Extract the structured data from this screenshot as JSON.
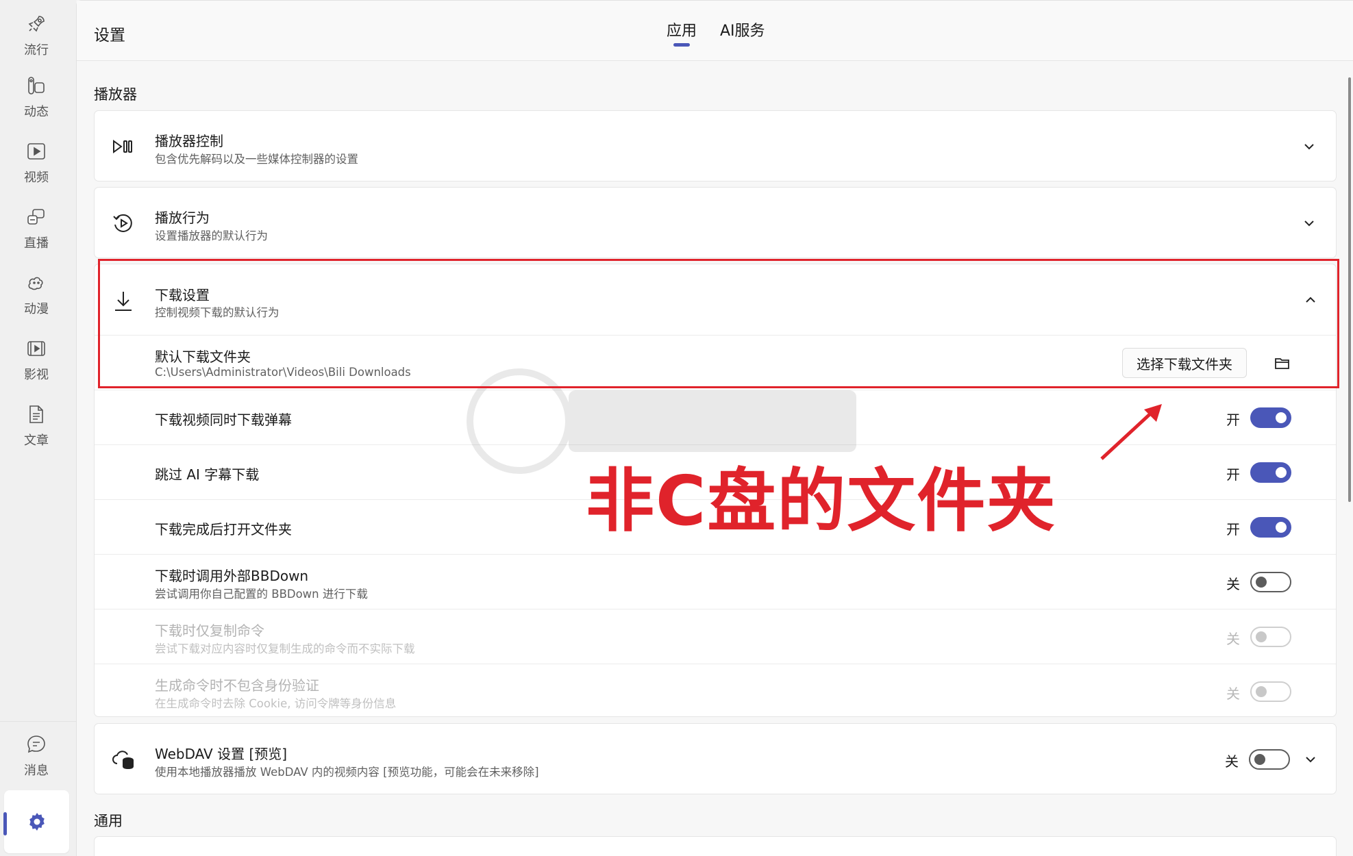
{
  "sidebar": {
    "items": [
      {
        "label": "流行",
        "icon": "rocket-icon"
      },
      {
        "label": "动态",
        "icon": "dynamics-icon"
      },
      {
        "label": "视频",
        "icon": "video-icon"
      },
      {
        "label": "直播",
        "icon": "live-icon"
      },
      {
        "label": "动漫",
        "icon": "anime-icon"
      },
      {
        "label": "影视",
        "icon": "film-icon"
      },
      {
        "label": "文章",
        "icon": "article-icon"
      }
    ],
    "bottom": [
      {
        "label": "消息",
        "icon": "message-icon"
      },
      {
        "label": "",
        "icon": "gear-icon",
        "active": true
      }
    ]
  },
  "header": {
    "title": "设置",
    "tabs": [
      "应用",
      "AI服务"
    ],
    "active_tab": "应用"
  },
  "sections": {
    "player_label": "播放器",
    "general_label": "通用"
  },
  "player_control": {
    "title": "播放器控制",
    "desc": "包含优先解码以及一些媒体控制器的设置"
  },
  "playback_behavior": {
    "title": "播放行为",
    "desc": "设置播放器的默认行为"
  },
  "download_settings": {
    "title": "下载设置",
    "desc": "控制视频下载的默认行为",
    "default_folder": {
      "title": "默认下载文件夹",
      "path": "C:\\Users\\Administrator\\Videos\\Bili Downloads",
      "button_label": "选择下载文件夹"
    },
    "rows": [
      {
        "title": "下载视频同时下载弹幕",
        "desc": "",
        "state_label": "开",
        "on": true,
        "enabled": true
      },
      {
        "title": "跳过 AI 字幕下载",
        "desc": "",
        "state_label": "开",
        "on": true,
        "enabled": true
      },
      {
        "title": "下载完成后打开文件夹",
        "desc": "",
        "state_label": "开",
        "on": true,
        "enabled": true
      },
      {
        "title": "下载时调用外部BBDown",
        "desc": "尝试调用你自己配置的 BBDown 进行下载",
        "state_label": "关",
        "on": false,
        "enabled": true
      },
      {
        "title": "下载时仅复制命令",
        "desc": "尝试下载对应内容时仅复制生成的命令而不实际下载",
        "state_label": "关",
        "on": false,
        "enabled": false
      },
      {
        "title": "生成命令时不包含身份验证",
        "desc": "在生成命令时去除 Cookie, 访问令牌等身份信息",
        "state_label": "关",
        "on": false,
        "enabled": false
      }
    ]
  },
  "webdav": {
    "title": "WebDAV 设置 [预览]",
    "desc": "使用本地播放器播放 WebDAV 内的视频内容 [预览功能，可能会在未来移除]",
    "state_label": "关",
    "on": false
  },
  "annotation": {
    "text": "非C盘的文件夹",
    "color": "#e0232b"
  },
  "colors": {
    "accent": "#4a57b8"
  }
}
